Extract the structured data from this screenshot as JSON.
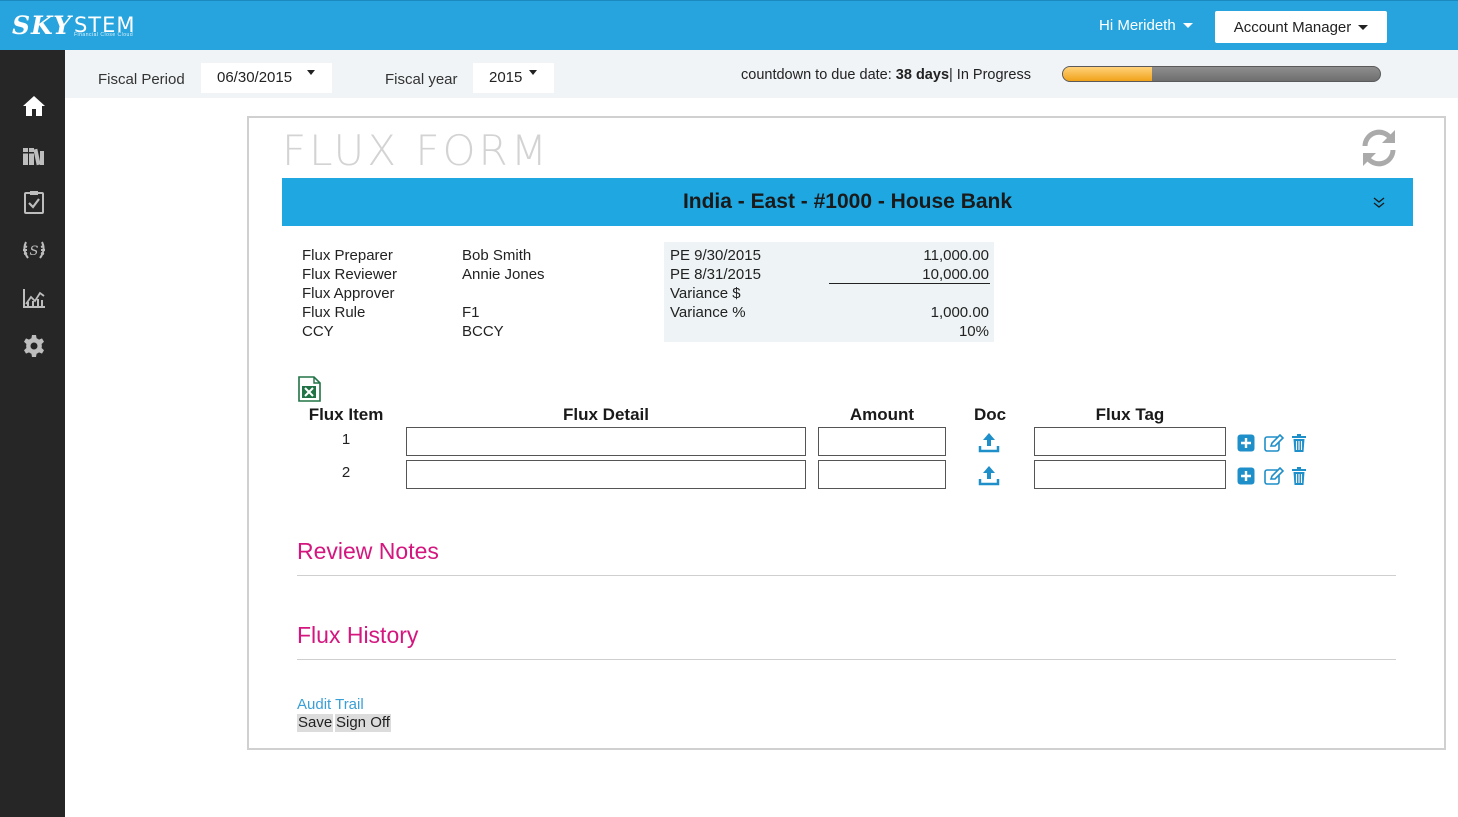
{
  "app": {
    "logo_primary": "SKY",
    "logo_secondary": "STEM",
    "logo_tagline": "Financial Close Cloud",
    "greeting": "Hi Merideth",
    "role": "Account Manager"
  },
  "sidebar": {
    "items": [
      {
        "icon": "home-icon"
      },
      {
        "icon": "books-icon"
      },
      {
        "icon": "checklist-icon"
      },
      {
        "icon": "laurel-icon"
      },
      {
        "icon": "chart-icon"
      },
      {
        "icon": "gear-icon"
      }
    ]
  },
  "filters": {
    "fiscal_period_label": "Fiscal Period",
    "fiscal_period_value": "06/30/2015",
    "fiscal_year_label": "Fiscal year",
    "fiscal_year_value": "2015",
    "countdown_prefix": "countdown to due date: ",
    "countdown_days": "38 days",
    "countdown_status": "| In Progress",
    "progress_fraction": 0.28,
    "progress_color": "#f0a21a"
  },
  "form": {
    "title": "FLUX FORM",
    "banner": "India - East - #1000 - House Bank",
    "banner_color": "#1ea7e1",
    "info": [
      {
        "label": "Flux Preparer",
        "value": "Bob Smith"
      },
      {
        "label": "Flux Reviewer",
        "value": "Annie Jones"
      },
      {
        "label": "Flux Approver",
        "value": ""
      },
      {
        "label": "Flux Rule",
        "value": "F1"
      },
      {
        "label": "CCY",
        "value": "BCCY"
      }
    ],
    "pe": [
      {
        "label": "PE 9/30/2015",
        "value": "11,000.00"
      },
      {
        "label": "PE 8/31/2015",
        "value": "10,000.00"
      },
      {
        "label": "Variance $",
        "value": ""
      },
      {
        "label": "Variance %",
        "value": "1,000.00"
      },
      {
        "label": "",
        "value": "10%"
      }
    ],
    "table": {
      "headers": {
        "item": "Flux Item",
        "detail": "Flux Detail",
        "amount": "Amount",
        "doc": "Doc",
        "tag": "Flux Tag"
      },
      "rows": [
        {
          "num": "1",
          "detail": "",
          "amount": "",
          "tag": ""
        },
        {
          "num": "2",
          "detail": "",
          "amount": "",
          "tag": ""
        }
      ]
    },
    "review_notes_title": "Review Notes",
    "flux_history_title": "Flux History",
    "section_color": "#d4167f",
    "audit_trail": "Audit Trail",
    "save_label": "Save",
    "sign_off_label": "Sign Off"
  }
}
